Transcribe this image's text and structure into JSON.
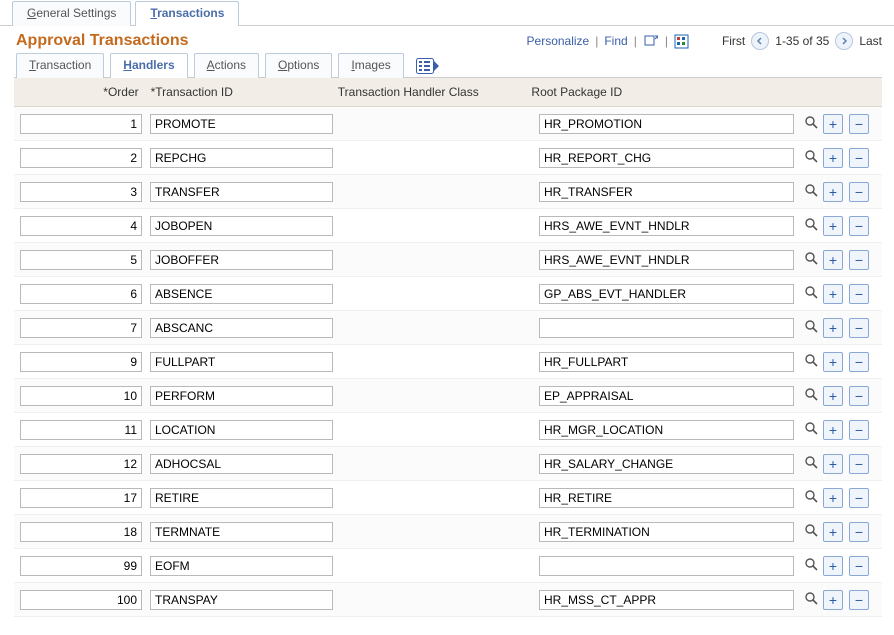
{
  "page_tabs": {
    "general": "General Settings",
    "general_ul": "G",
    "transactions": "Transactions",
    "transactions_ul": "T"
  },
  "title": "Approval Transactions",
  "toolbar": {
    "personalize": "Personalize",
    "find": "Find",
    "first": "First",
    "range": "1-35 of 35",
    "last": "Last"
  },
  "sub_tabs": {
    "transaction": "Transaction",
    "transaction_ul": "T",
    "handlers": "Handlers",
    "handlers_ul": "H",
    "actions": "Actions",
    "actions_ul": "A",
    "options": "Options",
    "options_ul": "O",
    "images": "Images",
    "images_ul": "I"
  },
  "headers": {
    "order": "*Order",
    "txn_id": "*Transaction ID",
    "thc": "Transaction Handler Class",
    "root": "Root Package ID"
  },
  "rows": [
    {
      "order": "1",
      "txn": "PROMOTE",
      "root": "HR_PROMOTION"
    },
    {
      "order": "2",
      "txn": "REPCHG",
      "root": "HR_REPORT_CHG"
    },
    {
      "order": "3",
      "txn": "TRANSFER",
      "root": "HR_TRANSFER"
    },
    {
      "order": "4",
      "txn": "JOBOPEN",
      "root": "HRS_AWE_EVNT_HNDLR"
    },
    {
      "order": "5",
      "txn": "JOBOFFER",
      "root": "HRS_AWE_EVNT_HNDLR"
    },
    {
      "order": "6",
      "txn": "ABSENCE",
      "root": "GP_ABS_EVT_HANDLER"
    },
    {
      "order": "7",
      "txn": "ABSCANC",
      "root": ""
    },
    {
      "order": "9",
      "txn": "FULLPART",
      "root": "HR_FULLPART"
    },
    {
      "order": "10",
      "txn": "PERFORM",
      "root": "EP_APPRAISAL"
    },
    {
      "order": "11",
      "txn": "LOCATION",
      "root": "HR_MGR_LOCATION"
    },
    {
      "order": "12",
      "txn": "ADHOCSAL",
      "root": "HR_SALARY_CHANGE"
    },
    {
      "order": "17",
      "txn": "RETIRE",
      "root": "HR_RETIRE"
    },
    {
      "order": "18",
      "txn": "TERMNATE",
      "root": "HR_TERMINATION"
    },
    {
      "order": "99",
      "txn": "EOFM",
      "root": ""
    },
    {
      "order": "100",
      "txn": "TRANSPAY",
      "root": "HR_MSS_CT_APPR"
    }
  ]
}
